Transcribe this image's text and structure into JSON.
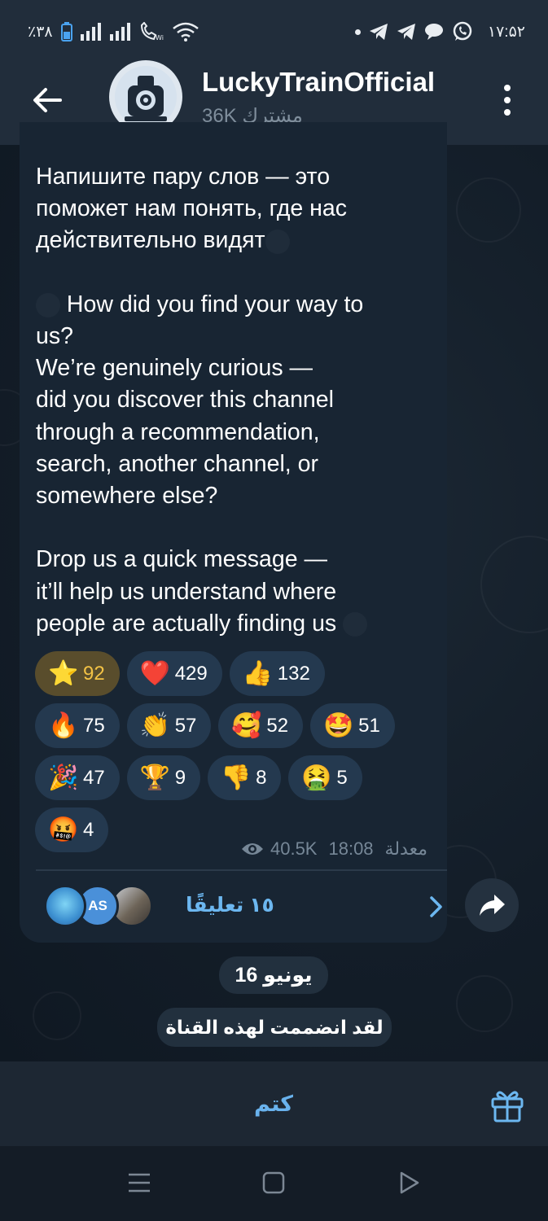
{
  "status_bar": {
    "battery": "٪۳۸",
    "time": "۱۷:۵۲",
    "icons_left": [
      "battery-icon",
      "signal-icon",
      "signal-icon",
      "wifi-calling-icon",
      "wifi-icon"
    ],
    "icons_right": [
      "dot-icon",
      "telegram-icon",
      "telegram-icon",
      "chat-icon",
      "whatsapp-icon"
    ]
  },
  "header": {
    "title": "LuckyTrainOfficial",
    "subscribers": "36K مشترك"
  },
  "message": {
    "text_ru": "Напишите пару слов — это\nпоможет нам понять, где нас\nдействительно видят",
    "text_en_line1": "How did you find your way to\nus?\nWe’re genuinely curious —\ndid you discover this channel\nthrough a recommendation,\nsearch, another channel, or\nsomewhere else?",
    "text_en_line2": "Drop us a quick message —\nit’ll help us understand where\npeople are actually finding us",
    "views": "40.5K",
    "time": "18:08",
    "edited": "معدلة"
  },
  "reactions": [
    {
      "emoji": "⭐",
      "count": "92",
      "active": true
    },
    {
      "emoji": "❤️",
      "count": "429"
    },
    {
      "emoji": "👍",
      "count": "132"
    },
    {
      "emoji": "🔥",
      "count": "75"
    },
    {
      "emoji": "👏",
      "count": "57"
    },
    {
      "emoji": "🥰",
      "count": "52"
    },
    {
      "emoji": "🤩",
      "count": "51"
    },
    {
      "emoji": "🎉",
      "count": "47"
    },
    {
      "emoji": "🏆",
      "count": "9"
    },
    {
      "emoji": "👎",
      "count": "8"
    },
    {
      "emoji": "🤮",
      "count": "5"
    },
    {
      "emoji": "🤬",
      "count": "4"
    }
  ],
  "comments": {
    "label": "١٥ تعليقًا",
    "avatar_initials": "AS"
  },
  "service": {
    "date": "16 يونيو",
    "joined": "لقد انضممت لهذه القناة"
  },
  "bottom": {
    "mute_label": "كتم"
  },
  "colors": {
    "accent": "#6cb7f0",
    "bubble": "#182533",
    "header": "#212d3b",
    "star_count": "#f3c245"
  }
}
